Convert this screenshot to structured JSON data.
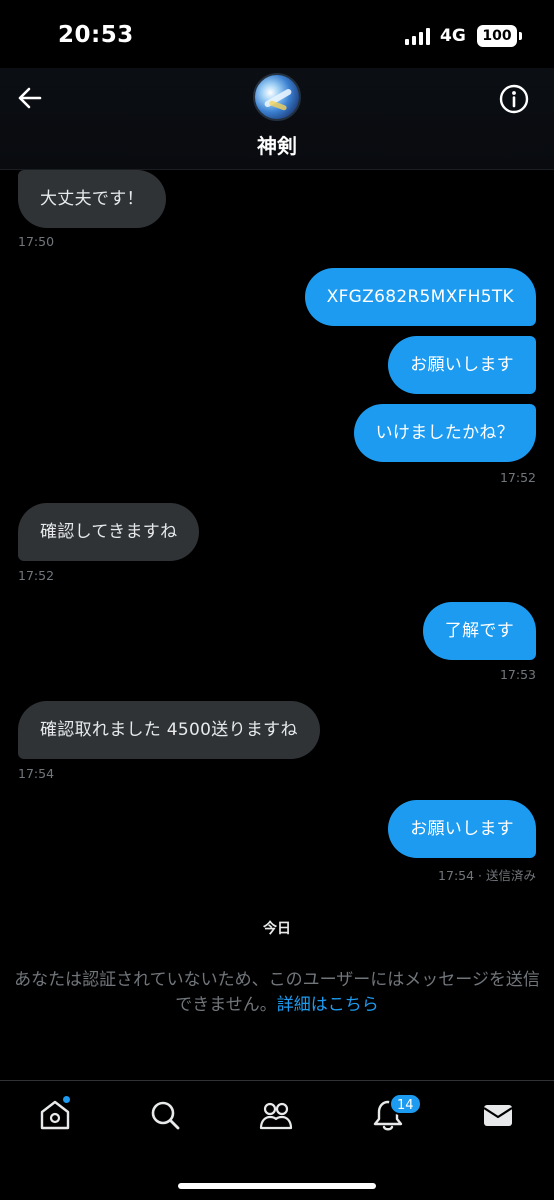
{
  "status": {
    "time": "20:53",
    "network": "4G",
    "battery": "100"
  },
  "header": {
    "contact_name": "神剣"
  },
  "messages": [
    {
      "text": "大丈夫です！",
      "time": "17:50"
    },
    {
      "text": "XFGZ682R5MXFH5TK"
    },
    {
      "text": "お願いします"
    },
    {
      "text": "いけましたかね？",
      "time": "17:52"
    },
    {
      "text": "確認してきますね",
      "time": "17:52"
    },
    {
      "text": "了解です",
      "time": "17:53"
    },
    {
      "text": "確認取れました 4500送りますね",
      "time": "17:54"
    },
    {
      "text": "お願いします",
      "time": "17:54 · 送信済み"
    }
  ],
  "divider": {
    "label": "今日"
  },
  "notice": {
    "text": "あなたは認証されていないため、このユーザーにはメッセージを送信できません。",
    "link": "詳細はこちら"
  },
  "tabbar": {
    "notifications_badge": "14"
  },
  "colors": {
    "accent": "#1d9bf0",
    "incoming_bubble": "#2f3336",
    "background": "#000000",
    "muted_text": "#71767b"
  },
  "icons": [
    "back-arrow-icon",
    "info-icon",
    "home-icon",
    "search-icon",
    "communities-icon",
    "bell-icon",
    "mail-icon"
  ]
}
